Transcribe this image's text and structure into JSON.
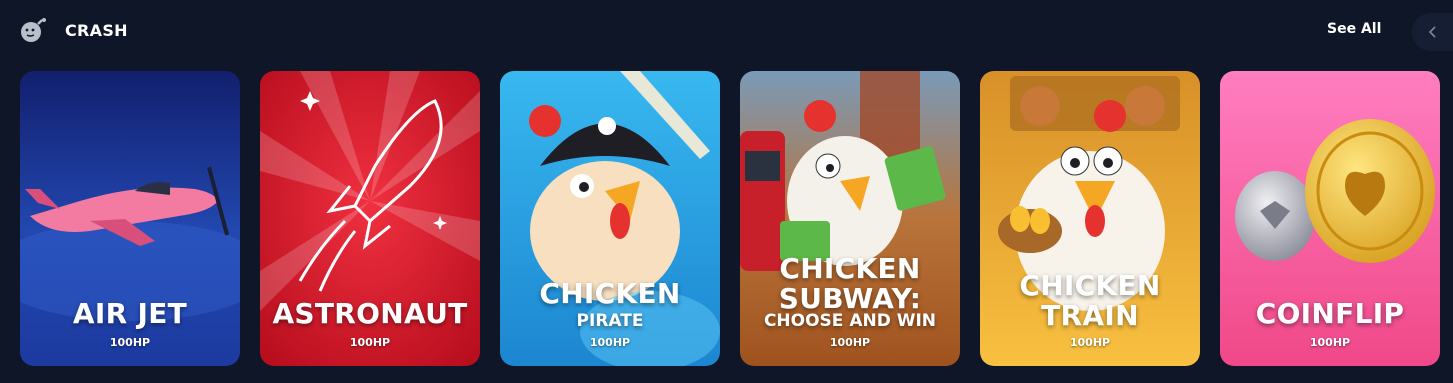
{
  "section": {
    "title": "CRASH",
    "icon": "bomb-icon",
    "see_all_label": "See All",
    "prev_icon": "chevron-left-icon"
  },
  "games": [
    {
      "title": "AIR JET",
      "subtitle": "",
      "price": "100HP",
      "bg": "#1e3a9a"
    },
    {
      "title": "ASTRONAUT",
      "subtitle": "",
      "price": "100HP",
      "bg": "#d81a2a"
    },
    {
      "title": "CHICKEN",
      "subtitle": "PIRATE",
      "price": "100HP",
      "bg": "#2aa6e8"
    },
    {
      "title": "CHICKEN SUBWAY:",
      "subtitle": "CHOOSE AND WIN",
      "price": "100HP",
      "bg": "#c86a2c"
    },
    {
      "title": "CHICKEN TRAIN",
      "subtitle": "",
      "price": "100HP",
      "bg": "#f0a830"
    },
    {
      "title": "COINFLIP",
      "subtitle": "",
      "price": "100HP",
      "bg": "#f4589a"
    }
  ]
}
